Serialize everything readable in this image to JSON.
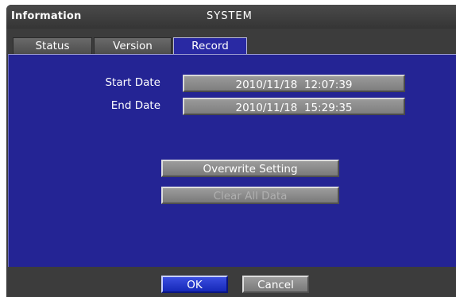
{
  "header": {
    "app_title": "Information",
    "dialog_title": "SYSTEM"
  },
  "tabs": [
    {
      "label": "Status",
      "active": false
    },
    {
      "label": "Version",
      "active": false
    },
    {
      "label": "Record",
      "active": true
    }
  ],
  "record": {
    "start_date_label": "Start Date",
    "start_date_value": "2010/11/18  12:07:39",
    "end_date_label": "End Date",
    "end_date_value": "2010/11/18  15:29:35",
    "overwrite_label": "Overwrite Setting",
    "clear_label": "Clear All Data"
  },
  "footer": {
    "ok_label": "OK",
    "cancel_label": "Cancel"
  },
  "colors": {
    "panel": "#242494",
    "window": "#3c3c3c",
    "ok_button": "#1f35cc",
    "field": "#8a8a8a"
  }
}
